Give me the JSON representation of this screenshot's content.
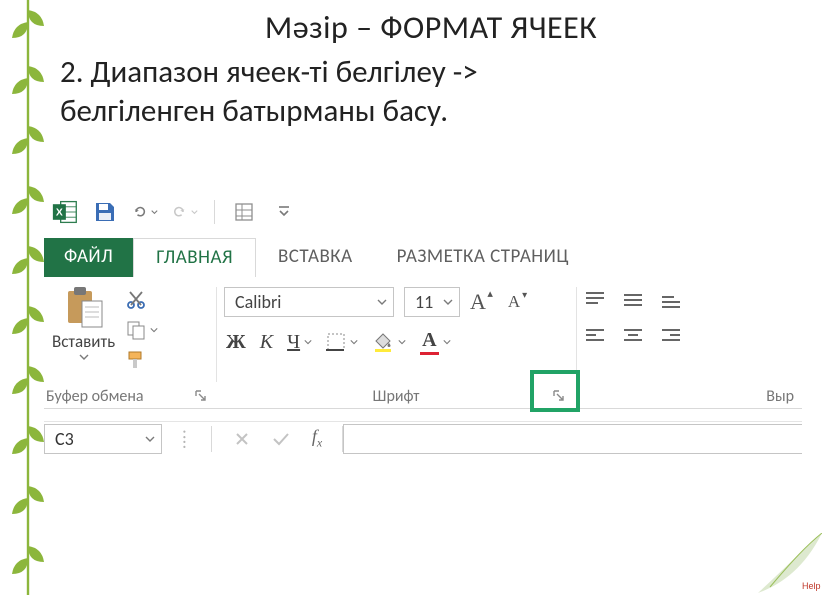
{
  "slide": {
    "title": "Мәзір – ФОРМАТ ЯЧЕЕК",
    "body_line1": "2. Диапазон ячеек-ті белгілеу ->",
    "body_line2": "белгіленген батырманы басу."
  },
  "excel": {
    "tabs": {
      "file": "ФАЙЛ",
      "home": "ГЛАВНАЯ",
      "insert": "ВСТАВКА",
      "pagelayout": "РАЗМЕТКА СТРАНИЦ"
    },
    "clipboard": {
      "paste_label": "Вставить",
      "group_label": "Буфер обмена"
    },
    "font": {
      "name": "Calibri",
      "size": "11",
      "bold": "Ж",
      "italic": "К",
      "underline": "Ч",
      "group_label": "Шрифт",
      "increase": "A",
      "decrease": "A"
    },
    "alignment": {
      "group_label_partial": "Выр"
    },
    "namebox": "C3",
    "fx_label": "fx"
  },
  "help_label": "Help"
}
